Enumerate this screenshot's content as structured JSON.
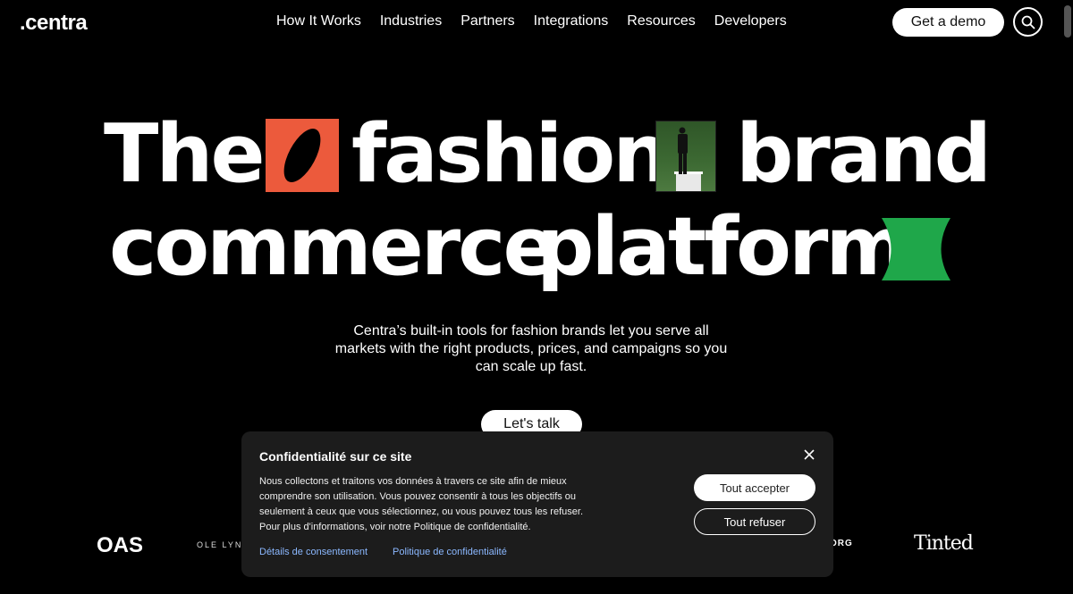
{
  "header": {
    "logo": ".centra",
    "nav": [
      "How It Works",
      "Industries",
      "Partners",
      "Integrations",
      "Resources",
      "Developers"
    ],
    "demo_label": "Get a demo"
  },
  "hero": {
    "word_the": "The",
    "word_fashion": "fashion",
    "word_brand": "brand",
    "word_commerce": "commerce",
    "word_platform": "platform",
    "subtitle": "Centra’s built-in tools for fashion brands let you serve all markets with the right products, prices, and campaigns so you can scale up fast.",
    "cta_label": "Let's talk"
  },
  "colors": {
    "orange_tile": "#ec5a3c",
    "green_tile": "#1fa74a"
  },
  "partners": {
    "oas": "OAS",
    "ole_lynggaard": "OLE LYNGGAARD",
    "org": "ORG",
    "tinted": "Tinted"
  },
  "cookie_modal": {
    "title": "Confidentialité sur ce site",
    "body": "Nous collectons et traitons vos données à travers ce site afin de mieux comprendre son utilisation. Vous pouvez consentir à tous les objectifs ou seulement à ceux que vous sélectionnez, ou vous pouvez tous les refuser. Pour plus d'informations, voir notre Politique de confidentialité.",
    "accept_label": "Tout accepter",
    "refuse_label": "Tout refuser",
    "consent_link": "Détails de consentement",
    "privacy_link": "Politique de confidentialité"
  }
}
